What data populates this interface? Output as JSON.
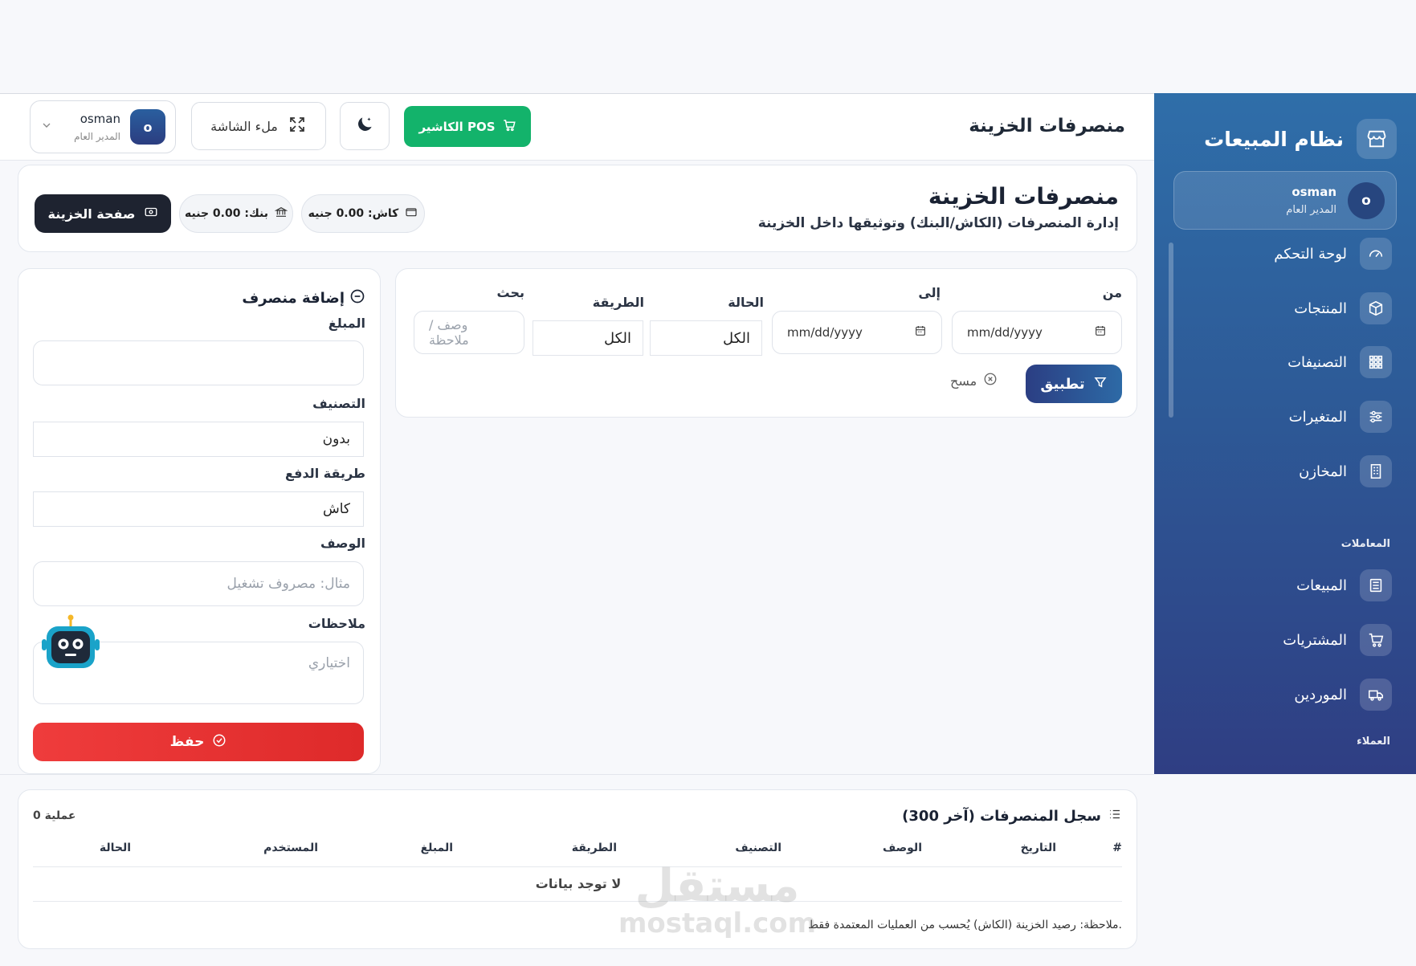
{
  "sidebar": {
    "brand": "نظام المبيعات",
    "user": {
      "avatar": "o",
      "name": "osman",
      "role": "المدير العام"
    },
    "items": [
      {
        "label": "لوحة التحكم",
        "icon": "dashboard-icon"
      },
      {
        "label": "المنتجات",
        "icon": "box-icon"
      },
      {
        "label": "التصنيفات",
        "icon": "grid-icon"
      },
      {
        "label": "المتغيرات",
        "icon": "sliders-icon"
      },
      {
        "label": "المخازن",
        "icon": "building-icon"
      },
      {
        "label": "المبيعات",
        "icon": "receipt-icon"
      },
      {
        "label": "المشتريات",
        "icon": "cart-icon"
      },
      {
        "label": "الموردين",
        "icon": "truck-icon"
      }
    ],
    "sections": {
      "transactions": "المعاملات",
      "customers": "العملاء"
    }
  },
  "topbar": {
    "title": "منصرفات الخزينة",
    "pos_label": "الكاشير POS",
    "fullscreen_label": "ملء الشاشة",
    "user": {
      "avatar": "o",
      "name": "osman",
      "role": "المدير العام"
    }
  },
  "header": {
    "title": "منصرفات الخزينة",
    "subtitle": "إدارة المنصرفات (الكاش/البنك) وتوثيقها داخل الخزينة",
    "cash_chip": "كاش: 0.00 جنيه",
    "bank_chip": "بنك: 0.00 جنيه",
    "treasury_button": "صفحة الخزينة"
  },
  "filters": {
    "from_label": "من",
    "to_label": "إلى",
    "status_label": "الحالة",
    "method_label": "الطريقة",
    "search_label": "بحث",
    "date_placeholder": "mm/dd/yyyy",
    "status_value": "الكل",
    "method_value": "الكل",
    "search_placeholder": "وصف / ملاحظة",
    "apply_label": "تطبيق",
    "clear_label": "مسح"
  },
  "add_form": {
    "title": "إضافة منصرف",
    "amount_label": "المبلغ",
    "amount_value": "",
    "category_label": "التصنيف",
    "category_value": "بدون",
    "payment_label": "طريقة الدفع",
    "payment_value": "كاش",
    "description_label": "الوصف",
    "description_placeholder": "مثال: مصروف تشغيل",
    "notes_label": "ملاحظات",
    "notes_placeholder": "اختياري",
    "save_label": "حفظ"
  },
  "log": {
    "title": "سجل المنصرفات (آخر 300)",
    "count": "0 عملية",
    "columns": [
      "#",
      "التاريخ",
      "الوصف",
      "التصنيف",
      "الطريقة",
      "المبلغ",
      "المستخدم",
      "الحالة"
    ],
    "empty": "لا توجد بيانات",
    "note": "ملاحظة: رصيد الخزينة (الكاش) يُحسب من العمليات المعتمدة فقط."
  },
  "watermark": {
    "ar": "مستقل",
    "en": "mostaql.com"
  },
  "colors": {
    "primary": "#2d5a97",
    "pos_green": "#13b36b",
    "danger": "#e53333",
    "dark": "#1e2330"
  }
}
